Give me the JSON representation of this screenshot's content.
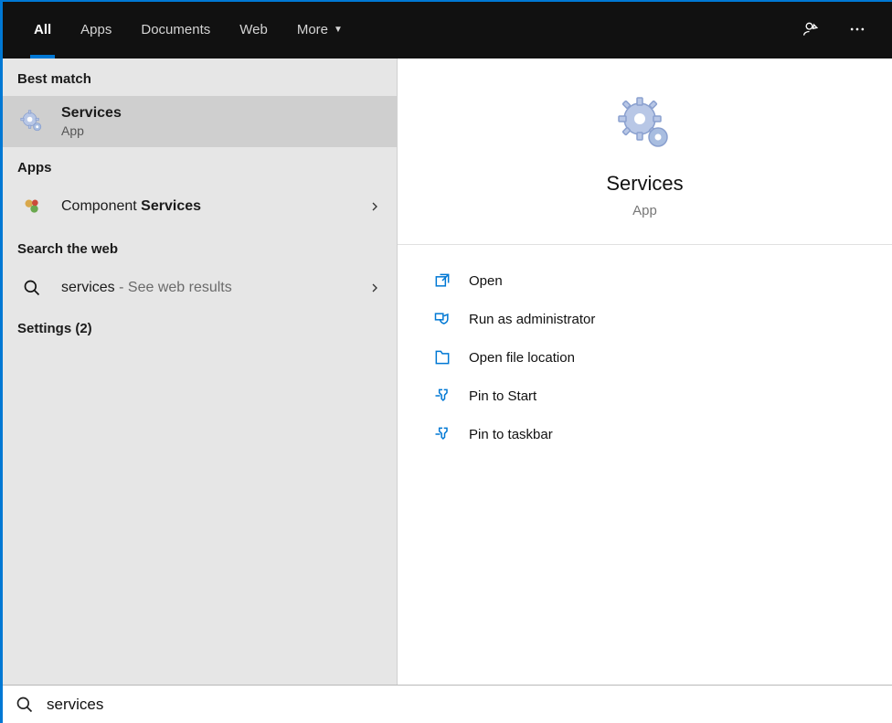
{
  "header": {
    "tabs": {
      "all": "All",
      "apps": "Apps",
      "documents": "Documents",
      "web": "Web",
      "more": "More"
    }
  },
  "left": {
    "best_match_label": "Best match",
    "best_match": {
      "title": "Services",
      "subtitle": "App"
    },
    "apps_label": "Apps",
    "component_services": {
      "prefix": "Component ",
      "match": "Services"
    },
    "web_label": "Search the web",
    "web_result": {
      "term": "services",
      "hint": " - See web results"
    },
    "settings_label": "Settings (2)"
  },
  "detail": {
    "title": "Services",
    "subtitle": "App",
    "actions": {
      "open": "Open",
      "run_admin": "Run as administrator",
      "open_loc": "Open file location",
      "pin_start": "Pin to Start",
      "pin_taskbar": "Pin to taskbar"
    }
  },
  "search": {
    "value": "services"
  }
}
